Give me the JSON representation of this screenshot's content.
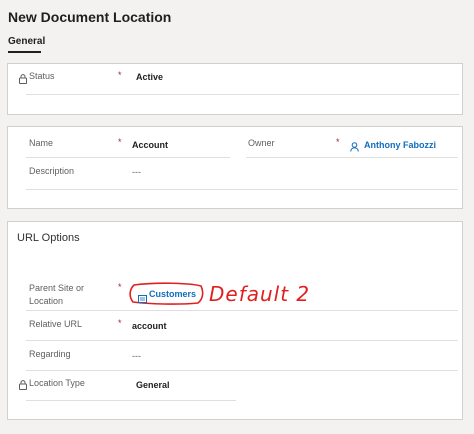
{
  "header": {
    "title": "New Document Location"
  },
  "tabs": [
    {
      "label": "General"
    }
  ],
  "status_section": {
    "status_label": "Status",
    "status_required": "*",
    "status_value": "Active"
  },
  "details_section": {
    "name_label": "Name",
    "name_required": "*",
    "name_value": "Account",
    "owner_label": "Owner",
    "owner_required": "*",
    "owner_value": "Anthony Fabozzi",
    "description_label": "Description",
    "description_value": "---"
  },
  "url_section": {
    "header": "URL Options",
    "parent_label_line1": "Parent Site or",
    "parent_label_line2": "Location",
    "parent_required": "*",
    "parent_value": "Customers",
    "relative_url_label": "Relative URL",
    "relative_url_required": "*",
    "relative_url_value": "account",
    "regarding_label": "Regarding",
    "regarding_value": "---",
    "location_type_label": "Location Type",
    "location_type_value": "General"
  },
  "annotation": {
    "text": "Default 2",
    "color": "#e02020"
  },
  "icons": {
    "lock": "lock-icon",
    "person": "person-icon",
    "record": "record-icon"
  },
  "colors": {
    "required": "#a4262c",
    "link": "#106ebe",
    "annotation": "#e02020"
  }
}
